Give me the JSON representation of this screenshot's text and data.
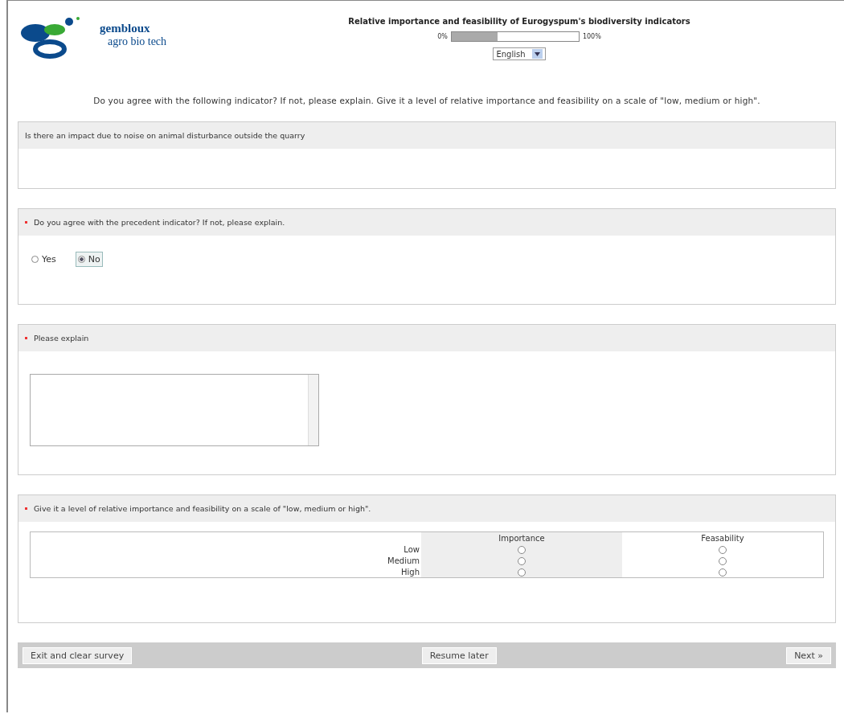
{
  "header": {
    "logo_line1": "gembloux",
    "logo_line2": "agro bio tech",
    "title": "Relative importance and feasibility of Eurogyspum's biodiversity indicators",
    "progress": {
      "start_label": "0%",
      "end_label": "100%",
      "level": 0.36
    },
    "language": "English"
  },
  "instruction": "Do you agree with the following indicator? If not, please explain. Give it a level of relative importance and feasibility on a scale of \"low, medium or high\".",
  "sections": [
    {
      "kind": "text",
      "required": false,
      "question": "Is there an impact due to noise on animal disturbance outside the quarry"
    },
    {
      "kind": "yesno",
      "required": true,
      "question": "Do you agree with the precedent indicator? If not, please explain.",
      "options": [
        {
          "label": "Yes",
          "selected": false
        },
        {
          "label": "No",
          "selected": true
        }
      ]
    },
    {
      "kind": "textarea",
      "required": true,
      "question": "Please explain"
    },
    {
      "kind": "matrix",
      "required": true,
      "question": "Give it a level of relative importance and feasibility on a scale of \"low, medium or high\".",
      "columns": [
        "Importance",
        "Feasability"
      ],
      "rows": [
        {
          "label": "Low",
          "selected": [
            false,
            false
          ]
        },
        {
          "label": "Medium",
          "selected": [
            false,
            false
          ]
        },
        {
          "label": "High",
          "selected": [
            false,
            false
          ]
        }
      ]
    }
  ],
  "buttons": {
    "exit": "Exit and clear survey",
    "resume": "Resume later",
    "next": "Next »"
  }
}
